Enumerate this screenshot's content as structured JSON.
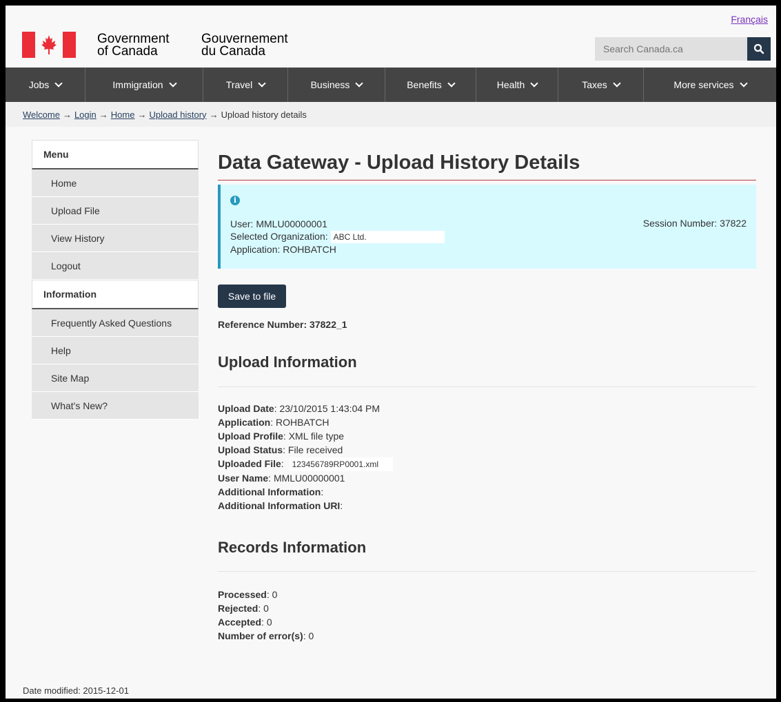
{
  "header": {
    "language_link": "Français",
    "signature_en_line1": "Government",
    "signature_en_line2": "of Canada",
    "signature_fr_line1": "Gouvernement",
    "signature_fr_line2": "du Canada",
    "search_placeholder": "Search Canada.ca",
    "search_icon": "search-icon"
  },
  "nav": [
    {
      "label": "Jobs"
    },
    {
      "label": "Immigration"
    },
    {
      "label": "Travel"
    },
    {
      "label": "Business"
    },
    {
      "label": "Benefits"
    },
    {
      "label": "Health"
    },
    {
      "label": "Taxes"
    },
    {
      "label": "More services"
    }
  ],
  "breadcrumb": {
    "links": [
      "Welcome",
      "Login",
      "Home",
      "Upload history"
    ],
    "current": "Upload history details"
  },
  "menu": {
    "heading": "Menu",
    "items": [
      "Home",
      "Upload File",
      "View History",
      "Logout"
    ],
    "info_heading": "Information",
    "info_items": [
      "Frequently Asked Questions",
      "Help",
      "Site Map",
      "What's New?"
    ]
  },
  "main": {
    "title": "Data Gateway - Upload History Details",
    "alert": {
      "user_label": "User:",
      "user_value": "MMLU00000001",
      "org_label": "Selected Organization:",
      "org_value": "ABC Ltd.",
      "app_label": "Application:",
      "app_value": "ROHBATCH",
      "session": "Session Number: 37822"
    },
    "save_button": "Save to file",
    "reference_label": "Reference Number:",
    "reference_value": "37822_1",
    "upload_heading": "Upload Information",
    "upload_fields": {
      "date_label": "Upload Date",
      "date_value": "23/10/2015 1:43:04 PM",
      "app_label": "Application",
      "app_value": "ROHBATCH",
      "profile_label": "Upload Profile",
      "profile_value": "XML file type",
      "status_label": "Upload Status",
      "status_value": "File received",
      "file_label": "Uploaded File",
      "file_value": "123456789RP0001.xml",
      "user_label": "User Name",
      "user_value": "MMLU00000001",
      "addinfo_label": "Additional Information",
      "addinfo_uri_label": "Additional Information URI"
    },
    "records_heading": "Records Information",
    "records_fields": {
      "processed_label": "Processed",
      "processed_value": "0",
      "rejected_label": "Rejected",
      "rejected_value": "0",
      "accepted_label": "Accepted",
      "accepted_value": "0",
      "errors_label": "Number of error(s)",
      "errors_value": "0"
    }
  },
  "footer": {
    "date_modified": "Date modified: 2015-12-01"
  },
  "colors": {
    "nav_bg": "#444444",
    "button_bg": "#26374a",
    "alert_bg": "#d7faff",
    "alert_border": "#269abc",
    "title_rule": "#af3c43",
    "flag_red": "#eb2d37"
  }
}
